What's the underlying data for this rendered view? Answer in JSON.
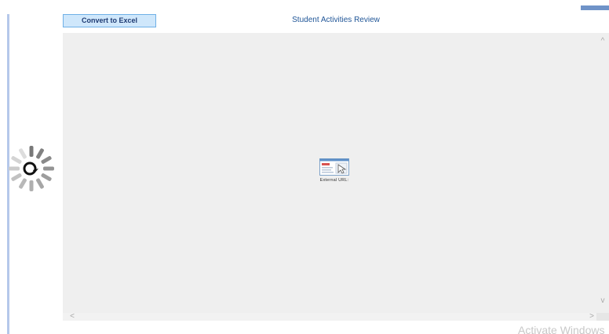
{
  "toolbar": {
    "convert_label": "Convert to Excel"
  },
  "report": {
    "title": "Student Activities Review",
    "external_url_label": "External URL:"
  },
  "viewer": {
    "scroll_up": "^",
    "scroll_down": "v",
    "scroll_left": "<",
    "scroll_right": ">"
  },
  "system": {
    "watermark": "Activate Windows"
  },
  "icons": {
    "loading": "loading-spinner-icon",
    "external_thumbnail": "external-link-thumbnail-icon"
  },
  "colors": {
    "accent": "#1f5597",
    "button_bg": "#cfe7fb",
    "button_border": "#6fb0e6",
    "viewer_bg": "#efefef",
    "left_rule": "#b5c8ea"
  }
}
